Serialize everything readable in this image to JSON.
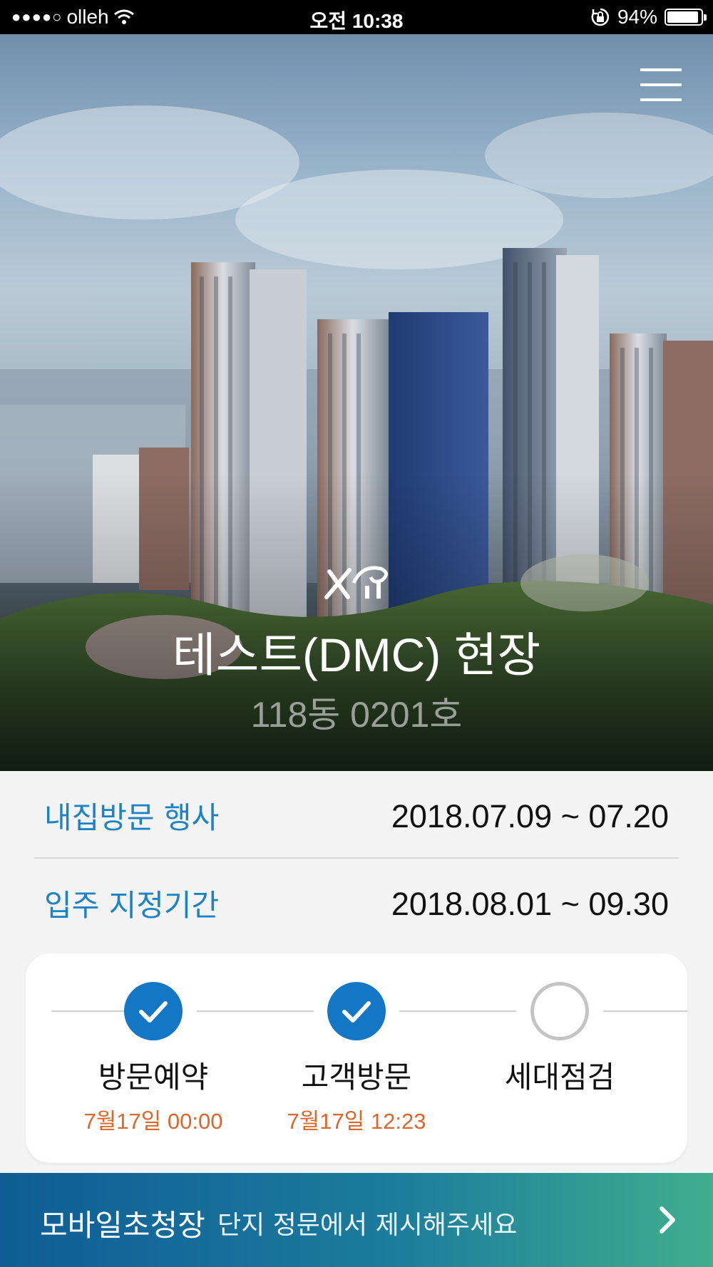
{
  "status_bar": {
    "signal_dots": "●●●●○",
    "carrier": "olleh",
    "time": "오전 10:38",
    "battery_percent": "94%",
    "battery_level": 0.94
  },
  "hero": {
    "site_name": "테스트(DMC) 현장",
    "unit": "118동 0201호",
    "logo_text": "Xi"
  },
  "schedule": [
    {
      "label": "내집방문 행사",
      "value": "2018.07.09 ~ 07.20"
    },
    {
      "label": "입주 지정기간",
      "value": "2018.08.01 ~ 09.30"
    }
  ],
  "progress": {
    "steps": [
      {
        "label": "방문예약",
        "time": "7월17일 00:00",
        "done": true
      },
      {
        "label": "고객방문",
        "time": "7월17일 12:23",
        "done": true
      },
      {
        "label": "세대점검",
        "time": "",
        "done": false
      }
    ],
    "done_color": "#1377c5",
    "time_color": "#e0652a"
  },
  "banner": {
    "title": "모바일초청장",
    "description": "단지 정문에서 제시해주세요"
  },
  "colors": {
    "label_blue": "#1b82c5"
  }
}
